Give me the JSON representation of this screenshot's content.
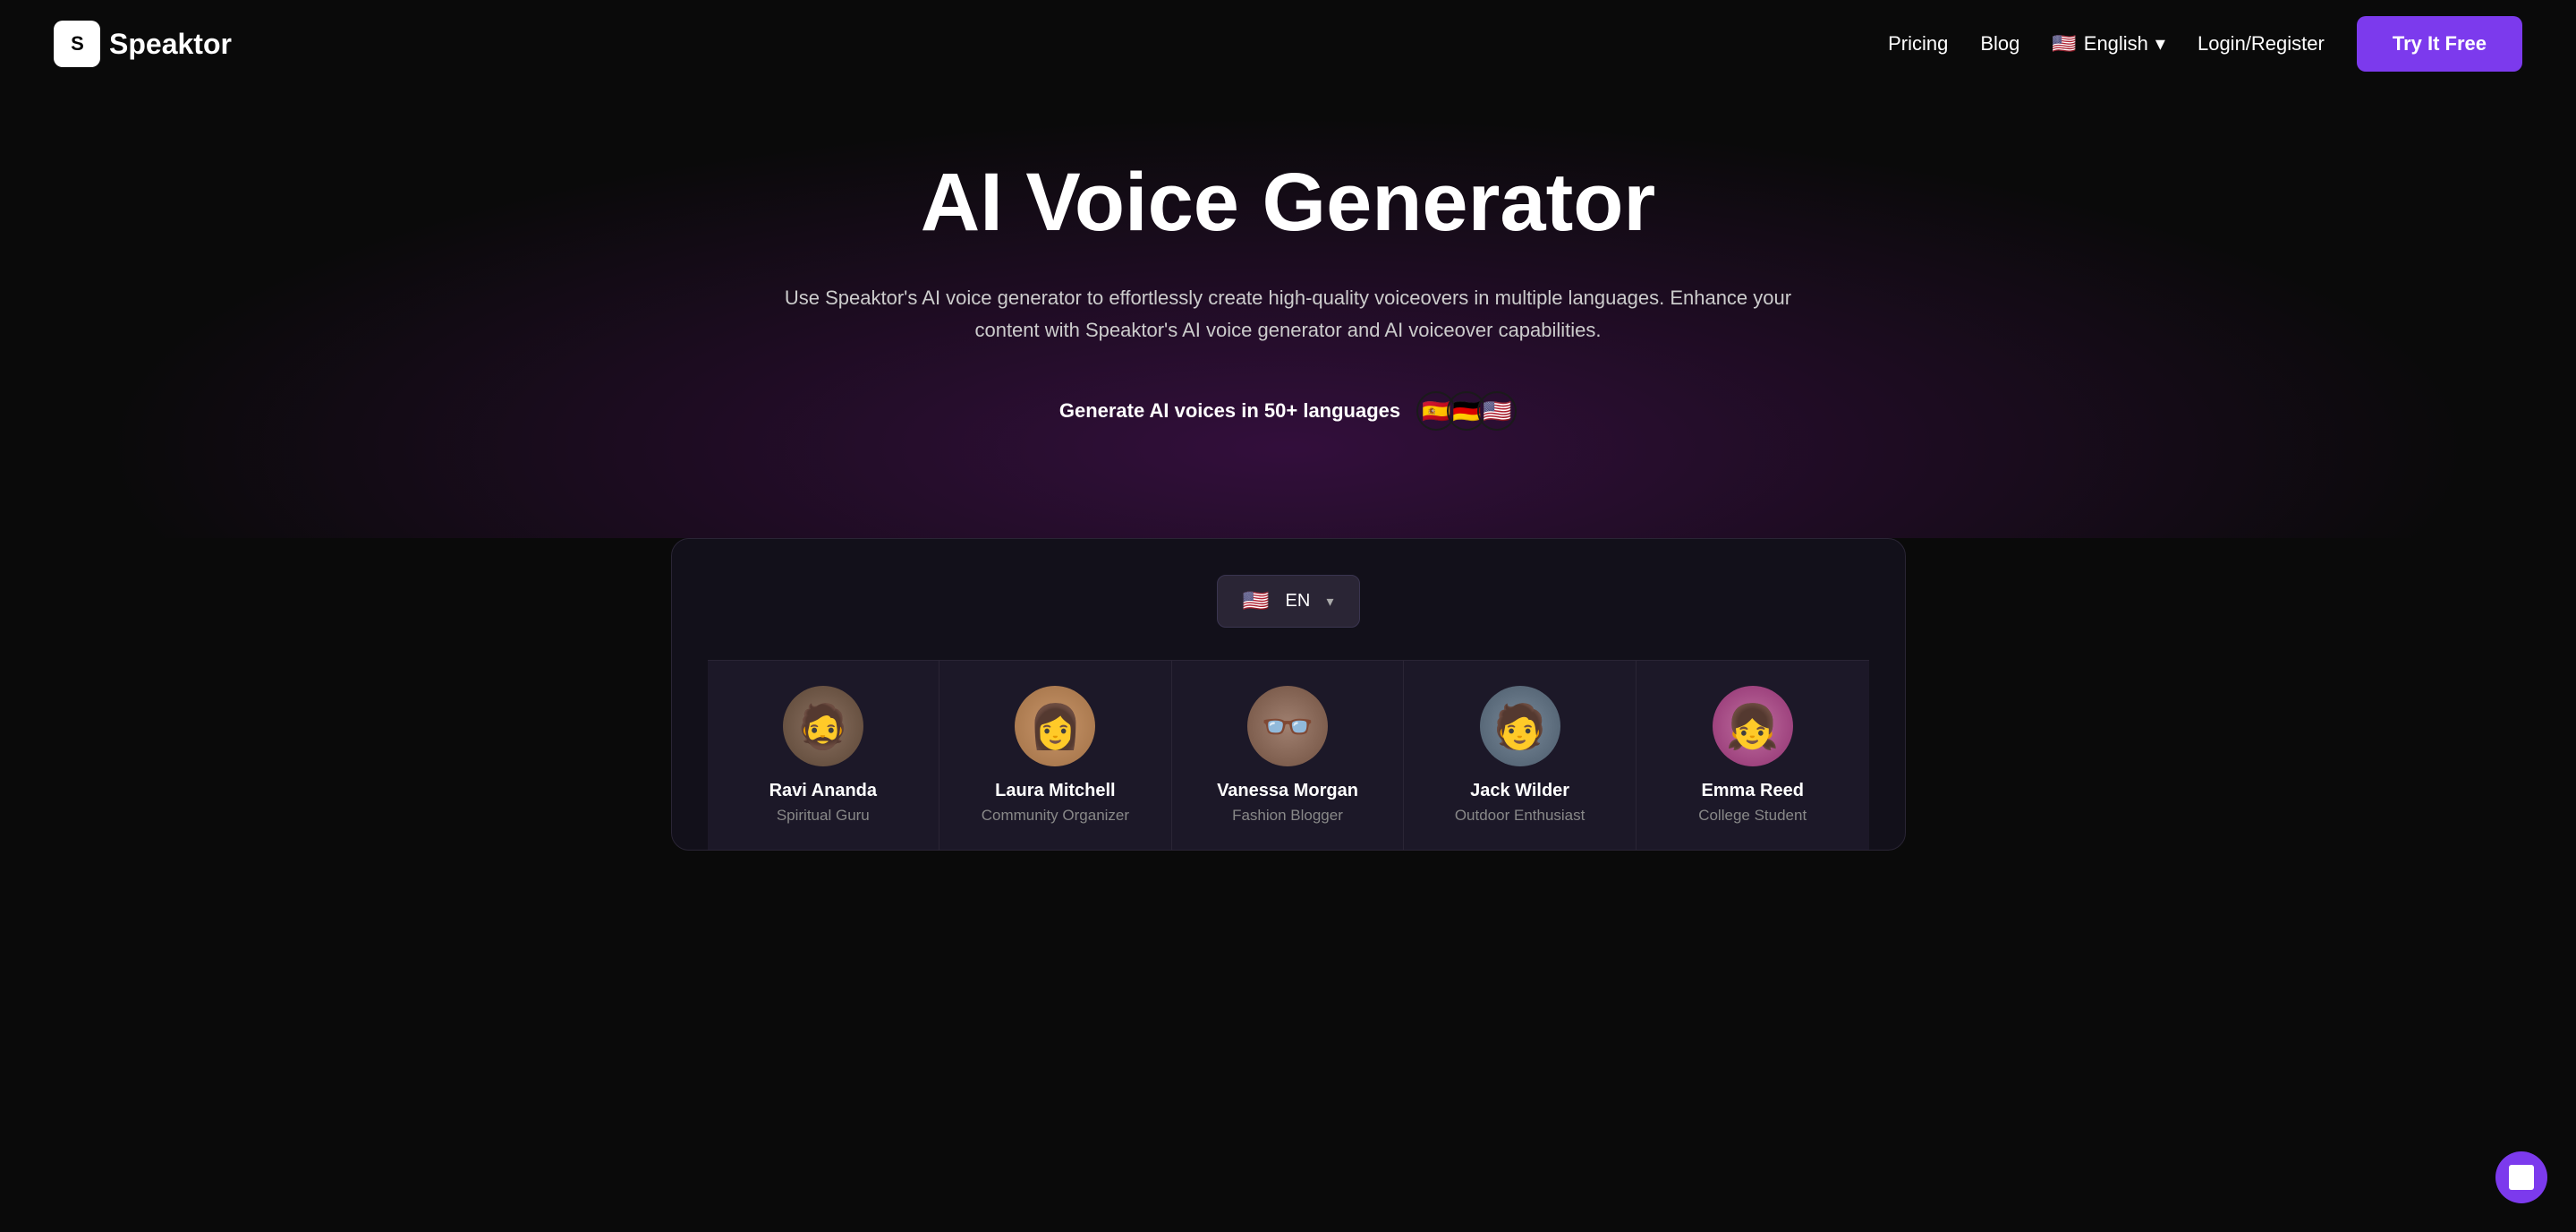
{
  "brand": {
    "logo_letter": "S",
    "logo_name": "peaktor"
  },
  "nav": {
    "pricing_label": "Pricing",
    "blog_label": "Blog",
    "language_label": "English",
    "login_label": "Login/Register",
    "cta_label": "Try It Free"
  },
  "hero": {
    "heading": "AI Voice Generator",
    "description": "Use Speaktor's AI voice generator to effortlessly create high-quality voiceovers in multiple languages. Enhance your content with Speaktor's AI voice generator and AI voiceover capabilities.",
    "languages_text": "Generate AI voices in 50+ languages",
    "flags": [
      "🇪🇸",
      "🇩🇪",
      "🇺🇸"
    ]
  },
  "preview": {
    "dropdown_label": "EN",
    "voices": [
      {
        "name": "Ravi Ananda",
        "role": "Spiritual Guru",
        "avatar_class": "avatar-ravi",
        "emoji": "🧔"
      },
      {
        "name": "Laura Mitchell",
        "role": "Community Organizer",
        "avatar_class": "avatar-laura",
        "emoji": "👩"
      },
      {
        "name": "Vanessa Morgan",
        "role": "Fashion Blogger",
        "avatar_class": "avatar-vanessa",
        "emoji": "👓"
      },
      {
        "name": "Jack Wilder",
        "role": "Outdoor Enthusiast",
        "avatar_class": "avatar-jack",
        "emoji": "🧑"
      },
      {
        "name": "Emma Reed",
        "role": "College Student",
        "avatar_class": "avatar-emma",
        "emoji": "👧"
      }
    ]
  },
  "colors": {
    "cta_bg": "#7c3aed",
    "preview_bg": "#12101a"
  }
}
